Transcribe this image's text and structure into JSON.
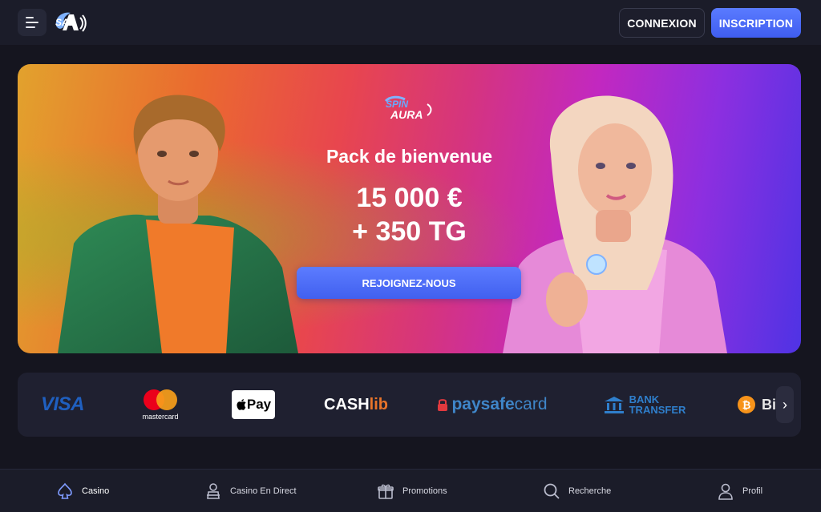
{
  "header": {
    "login_label": "CONNEXION",
    "signup_label": "INSCRIPTION",
    "logo_text": "SA"
  },
  "banner": {
    "brand": "SPIN AURA",
    "title": "Pack de bienvenue",
    "amount_line1": "15 000 €",
    "amount_line2": "+ 350 TG",
    "cta_label": "REJOIGNEZ-NOUS"
  },
  "payments": {
    "visa": "VISA",
    "mastercard": "mastercard",
    "applepay": "Pay",
    "cashlib_a": "CASH",
    "cashlib_b": "lib",
    "paysafe_a": "paysafe",
    "paysafe_b": "card",
    "bank_line1": "BANK",
    "bank_line2": "TRANSFER",
    "bitcoin": "Bi",
    "next": "›"
  },
  "bottom_nav": {
    "items": [
      {
        "label": "Casino",
        "icon": "spade-icon"
      },
      {
        "label": "Casino En Direct",
        "icon": "dealer-icon"
      },
      {
        "label": "Promotions",
        "icon": "gift-icon"
      },
      {
        "label": "Recherche",
        "icon": "search-icon"
      },
      {
        "label": "Profil",
        "icon": "user-icon"
      }
    ]
  },
  "colors": {
    "accent": "#4f6cf5",
    "background": "#15151f",
    "panel": "#1f2030"
  }
}
